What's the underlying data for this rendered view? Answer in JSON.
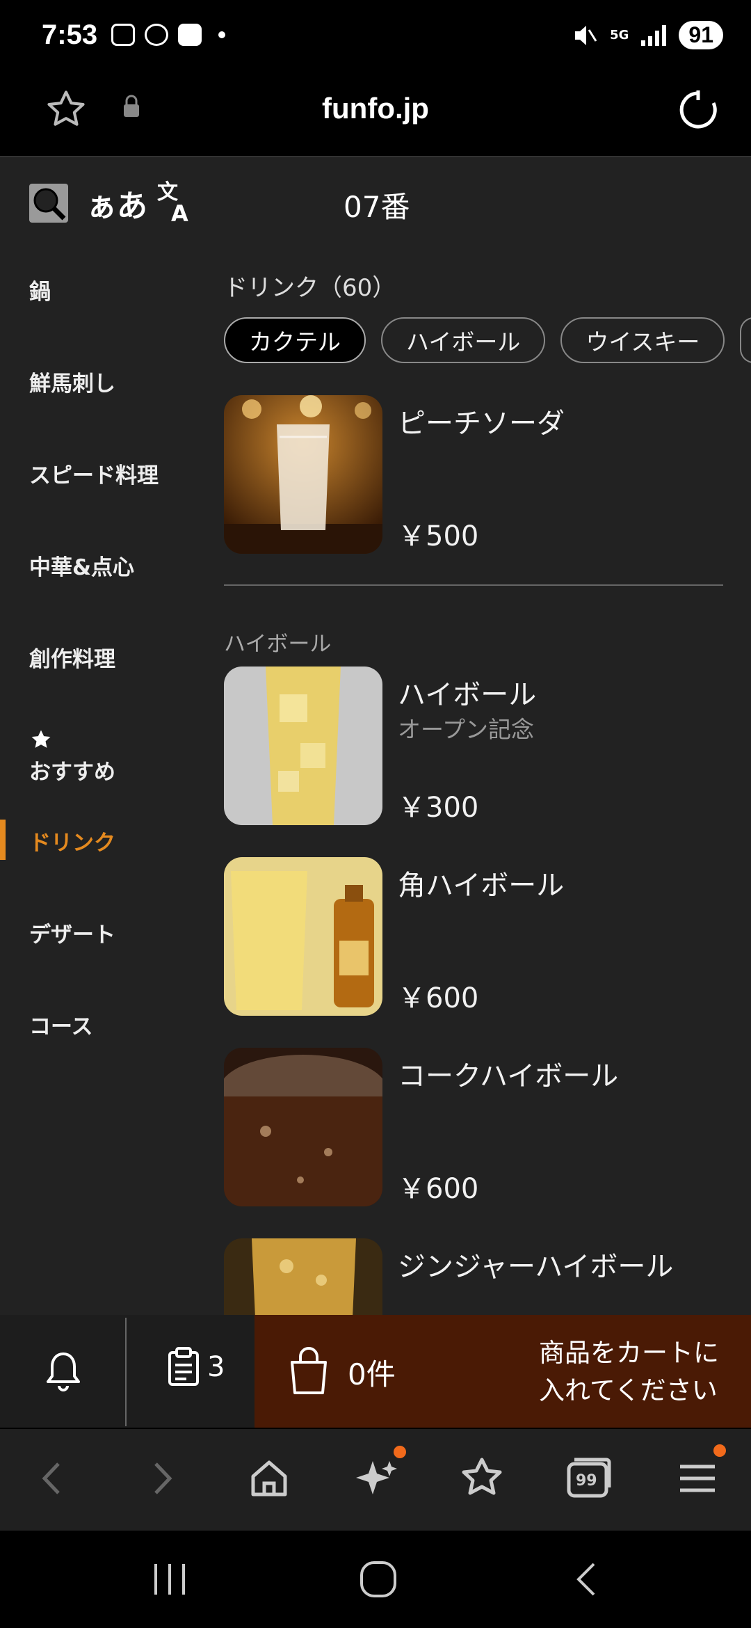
{
  "status_bar": {
    "time": "7:53",
    "network": "5G",
    "battery": "91",
    "icons": [
      "screenshot-icon",
      "line-icon",
      "tv-icon",
      "dot-icon",
      "mute-icon",
      "5g-icon",
      "signal-icon",
      "battery-icon"
    ]
  },
  "browser": {
    "url": "funfo.jp",
    "icons": [
      "star-icon",
      "lock-icon",
      "reload-icon"
    ]
  },
  "page_header": {
    "font_size_label": "ぁあ",
    "table_number": "07番",
    "icons": [
      "search-icon",
      "translate-icon"
    ]
  },
  "sidebar": {
    "items": [
      {
        "label": "鍋"
      },
      {
        "label": "鮮馬刺し"
      },
      {
        "label": "スピード料理"
      },
      {
        "label": "中華&点心"
      },
      {
        "label": "創作料理"
      },
      {
        "label": "おすすめ",
        "icon": "star-icon"
      },
      {
        "label": "ドリンク",
        "active": true
      },
      {
        "label": "デザート"
      },
      {
        "label": "コース"
      }
    ]
  },
  "main": {
    "section_title": "ドリンク（60）",
    "chips": [
      {
        "label": "カクテル",
        "selected": true
      },
      {
        "label": "ハイボール"
      },
      {
        "label": "ウイスキー"
      }
    ],
    "items": [
      {
        "name": "ピーチソーダ",
        "subtitle": "",
        "price": "￥500"
      },
      {
        "name": "ハイボール",
        "subtitle": "オープン記念",
        "price": "￥300"
      },
      {
        "name": "角ハイボール",
        "subtitle": "",
        "price": "￥600"
      },
      {
        "name": "コークハイボール",
        "subtitle": "",
        "price": "￥600"
      },
      {
        "name": "ジンジャーハイボール",
        "subtitle": "",
        "price": ""
      }
    ],
    "subheading": "ハイボール"
  },
  "bottom_bar": {
    "orders_count": "3",
    "cart_count": "0件",
    "cart_message_line1": "商品をカートに",
    "cart_message_line2": "入れてください",
    "icons": [
      "bell-icon",
      "clipboard-icon",
      "shopping-bag-icon"
    ]
  },
  "browser_nav": {
    "icons": [
      "back-icon",
      "forward-icon",
      "home-icon",
      "sparkle-icon",
      "bookmarks-icon",
      "tabs-icon",
      "menu-icon"
    ],
    "tabs_count": "99"
  },
  "colors": {
    "accent": "#e58a1f",
    "cart_bg": "#4a1a05",
    "badge": "#f26a1b",
    "content_bg": "#222222"
  }
}
